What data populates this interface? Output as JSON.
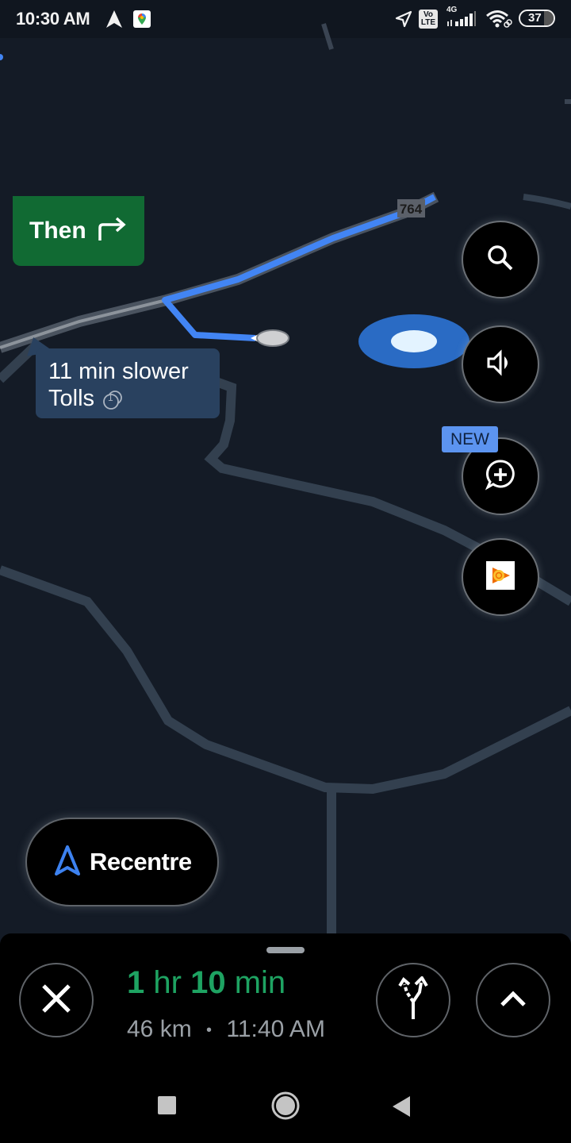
{
  "status_bar": {
    "time": "10:30 AM",
    "icons": [
      "navigation-arrow-icon",
      "google-maps-icon",
      "location-icon",
      "volte-icon",
      "signal-4g-icon",
      "wifi-icon",
      "battery-icon"
    ],
    "volte_line1": "Vo",
    "volte_line2": "LTE",
    "network": "4G",
    "battery_level": "37"
  },
  "map": {
    "road_shield": "764",
    "route_color": "#4285f4",
    "road_color": "#33404f"
  },
  "next_turn": {
    "label": "Then",
    "direction": "turn-right"
  },
  "alt_route_callout": {
    "line1": "11 min slower",
    "line2": "Tolls",
    "toll_count": "1"
  },
  "fabs": {
    "search": "search",
    "sound": "sound",
    "report": "add-report",
    "report_badge": "NEW",
    "media": "google-play-music"
  },
  "recentre": {
    "label": "Recentre"
  },
  "trip": {
    "eta_hours": "1",
    "eta_hr_unit": "hr",
    "eta_minutes": "10",
    "eta_min_unit": "min",
    "distance": "46 km",
    "separator": "•",
    "arrival": "11:40 AM",
    "accent_color": "#1ea362"
  },
  "nav_bar": {
    "buttons": [
      "recents",
      "home",
      "back"
    ]
  }
}
